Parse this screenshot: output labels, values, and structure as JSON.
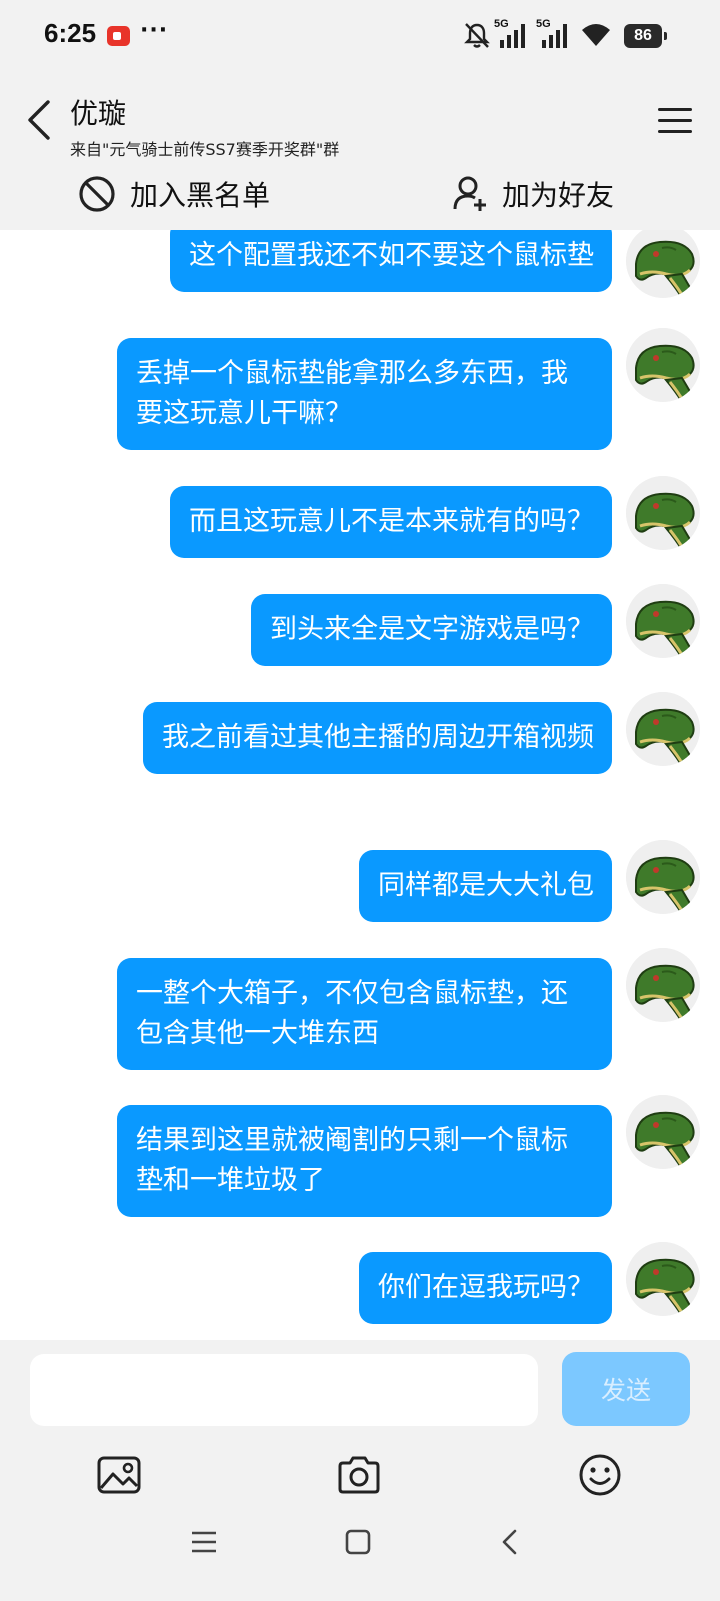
{
  "status_bar": {
    "time": "6:25",
    "more": "···",
    "signal1_label": "5G",
    "signal2_label": "5G",
    "battery": "86"
  },
  "header": {
    "title": "优璇",
    "subtitle": "来自\"元气骑士前传SS7赛季开奖群\"群",
    "block_label": "加入黑名单",
    "add_friend_label": "加为好友"
  },
  "messages": [
    "这个配置我还不如不要这个鼠标垫",
    "丢掉一个鼠标垫能拿那么多东西，我要这玩意儿干嘛？",
    "而且这玩意儿不是本来就有的吗？",
    "到头来全是文字游戏是吗？",
    "我之前看过其他主播的周边开箱视频",
    "同样都是大大礼包",
    "一整个大箱子，不仅包含鼠标垫，还包含其他一大堆东西",
    "结果到这里就被阉割的只剩一个鼠标垫和一堆垃圾了",
    "你们在逗我玩吗？"
  ],
  "composer": {
    "input_value": "",
    "input_placeholder": "",
    "send_label": "发送"
  },
  "colors": {
    "bubble": "#0a99ff",
    "send_disabled": "#7cc8ff",
    "background": "#f2f2f2"
  },
  "icons": {
    "tools": [
      "image-icon",
      "camera-icon",
      "emoji-icon"
    ],
    "nav": [
      "menu-nav-icon",
      "home-nav-icon",
      "back-nav-icon"
    ]
  }
}
